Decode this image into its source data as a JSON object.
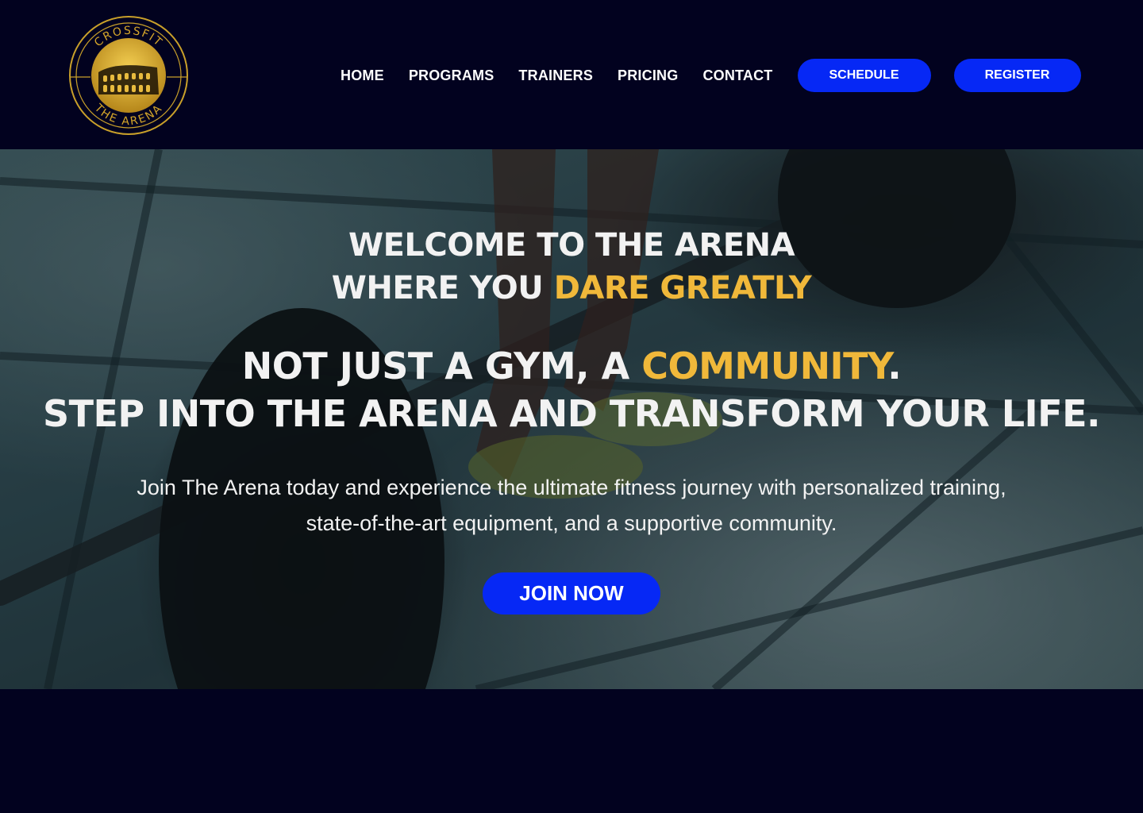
{
  "brand": {
    "logo_top_text": "CROSSFIT",
    "logo_bottom_text": "THE ARENA",
    "logo_icon": "colosseum-icon"
  },
  "nav": {
    "items": [
      {
        "label": "HOME"
      },
      {
        "label": "PROGRAMS"
      },
      {
        "label": "TRAINERS"
      },
      {
        "label": "PRICING"
      },
      {
        "label": "CONTACT"
      }
    ],
    "schedule_label": "SCHEDULE",
    "register_label": "REGISTER"
  },
  "hero": {
    "line1": "WELCOME TO THE ARENA",
    "line2_prefix": "WHERE YOU ",
    "line2_accent": "DARE GREATLY",
    "line3_prefix": "NOT JUST A GYM, A ",
    "line3_accent": "COMMUNITY",
    "line3_suffix": ".",
    "line4": "STEP INTO THE ARENA AND TRANSFORM YOUR LIFE.",
    "subtext": "Join The Arena today and experience the ultimate fitness journey with personalized training, state-of-the-art equipment, and a supportive community.",
    "cta_label": "JOIN NOW",
    "background_image": "barbell-deadlift-photo"
  },
  "colors": {
    "background": "#02021f",
    "button": "#0628f5",
    "accent": "#f0b83a",
    "text": "#ffffff",
    "logo_gold": "#d4a52a"
  }
}
